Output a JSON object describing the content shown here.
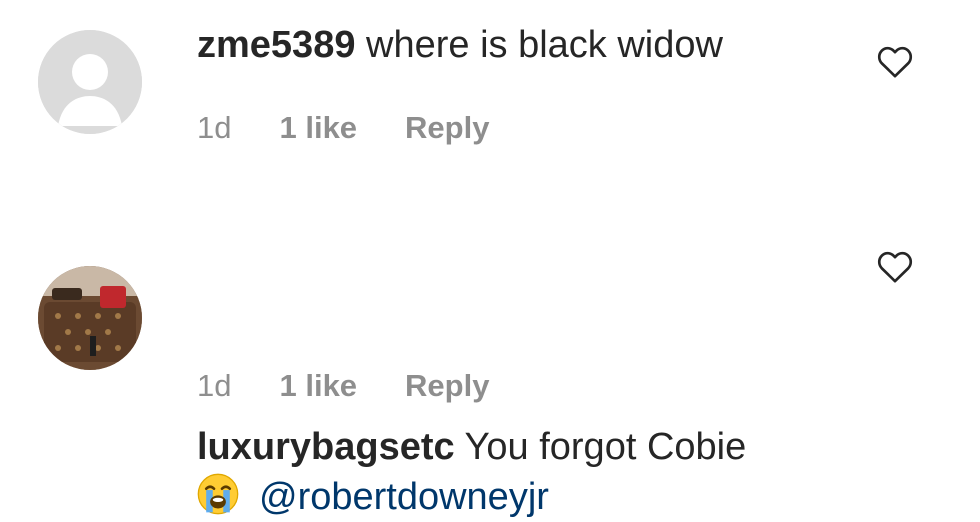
{
  "comments": [
    {
      "username": "zme5389",
      "text": "where is black widow",
      "mention": "",
      "time": "1d",
      "likes": "1 like",
      "reply": "Reply",
      "avatar_icon": "default-avatar-icon",
      "has_emoji": false
    },
    {
      "username": "luxurybagsetc",
      "text": "You forgot Cobie",
      "mention": "@robertdowneyjr",
      "time": "1d",
      "likes": "1 like",
      "reply": "Reply",
      "avatar_icon": "bag-photo-avatar",
      "has_emoji": true,
      "emoji_icon": "loudly-crying-face-emoji"
    }
  ],
  "colors": {
    "username": "#262626",
    "mention": "#00376b",
    "meta": "#8e8e8e",
    "heart": "#262626"
  }
}
